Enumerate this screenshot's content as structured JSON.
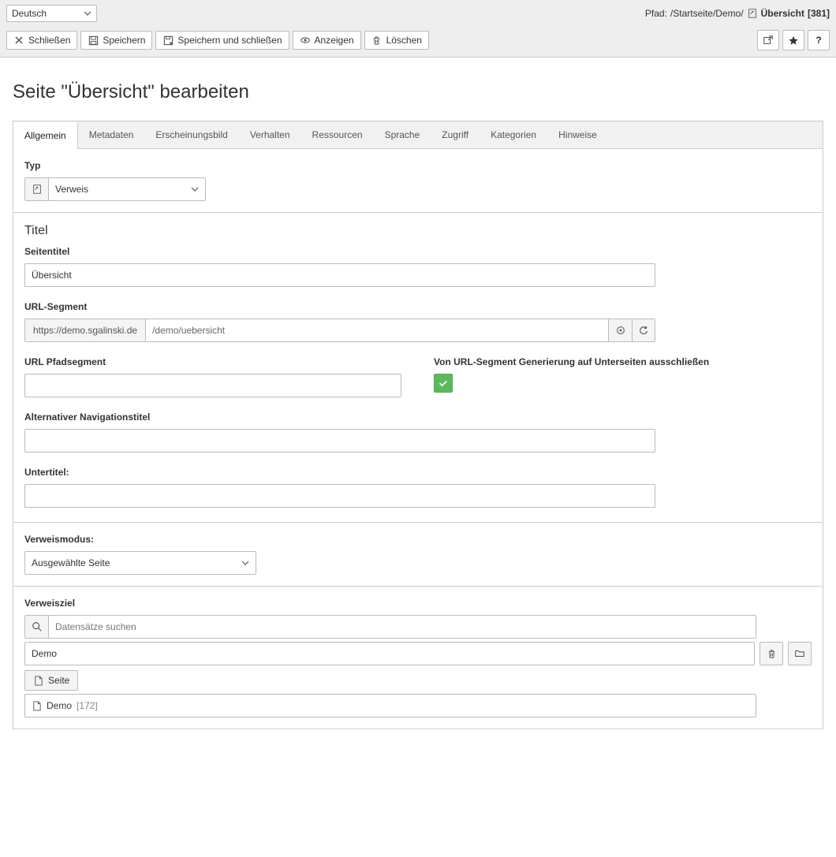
{
  "topbar": {
    "lang": "Deutsch",
    "path_label": "Pfad:",
    "path_value": "/Startseite/Demo/",
    "path_current": "Übersicht",
    "path_id": "[381]"
  },
  "toolbar": {
    "close": "Schließen",
    "save": "Speichern",
    "save_close": "Speichern und schließen",
    "view": "Anzeigen",
    "delete": "Löschen"
  },
  "page_title": "Seite \"Übersicht\" bearbeiten",
  "tabs": [
    "Allgemein",
    "Metadaten",
    "Erscheinungsbild",
    "Verhalten",
    "Ressourcen",
    "Sprache",
    "Zugriff",
    "Kategorien",
    "Hinweise"
  ],
  "general": {
    "type_label": "Typ",
    "type_value": "Verweis",
    "title_heading": "Titel",
    "page_title_label": "Seitentitel",
    "page_title_value": "Übersicht",
    "url_segment_label": "URL-Segment",
    "url_prefix": "https://demo.sgalinski.de",
    "url_value": "/demo/uebersicht",
    "url_path_label": "URL Pfadsegment",
    "url_path_value": "",
    "exclude_label": "Von URL-Segment Generierung auf Unterseiten ausschließen",
    "nav_title_label": "Alternativer Navigationstitel",
    "nav_title_value": "",
    "subtitle_label": "Untertitel:",
    "subtitle_value": "",
    "ref_mode_label": "Verweismodus:",
    "ref_mode_value": "Ausgewählte Seite",
    "ref_target_label": "Verweisziel",
    "search_placeholder": "Datensätze suchen",
    "selected_value": "Demo",
    "page_button": "Seite",
    "record_name": "Demo",
    "record_id": "[172]"
  }
}
